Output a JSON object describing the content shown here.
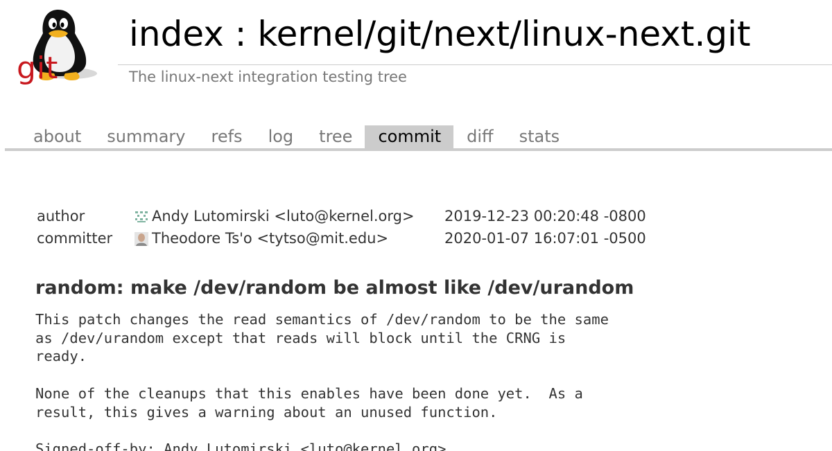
{
  "header": {
    "logo_text": "git",
    "title": "index : kernel/git/next/linux-next.git",
    "description": "The linux-next integration testing tree"
  },
  "tabs": [
    {
      "label": "about",
      "active": false
    },
    {
      "label": "summary",
      "active": false
    },
    {
      "label": "refs",
      "active": false
    },
    {
      "label": "log",
      "active": false
    },
    {
      "label": "tree",
      "active": false
    },
    {
      "label": "commit",
      "active": true
    },
    {
      "label": "diff",
      "active": false
    },
    {
      "label": "stats",
      "active": false
    }
  ],
  "commit_info": {
    "author": {
      "label": "author",
      "person": "Andy Lutomirski <luto@kernel.org>",
      "date": "2019-12-23 00:20:48 -0800",
      "avatar_icon": "identicon-avatar"
    },
    "committer": {
      "label": "committer",
      "person": "Theodore Ts'o <tytso@mit.edu>",
      "date": "2020-01-07 16:07:01 -0500",
      "avatar_icon": "photo-avatar"
    }
  },
  "commit_subject": "random: make /dev/random be almost like /dev/urandom",
  "commit_message": [
    "This patch changes the read semantics of /dev/random to be the same",
    "as /dev/urandom except that reads will block until the CRNG is",
    "ready.",
    "",
    "None of the cleanups that this enables have been done yet.  As a",
    "result, this gives a warning about an unused function.",
    "",
    "Signed-off-by: Andy Lutomirski <luto@kernel.org>"
  ],
  "colors": {
    "tab_active_bg": "#cccccc",
    "tab_text": "#777777",
    "logo_red": "#c8181e",
    "rule": "#cccccc"
  }
}
